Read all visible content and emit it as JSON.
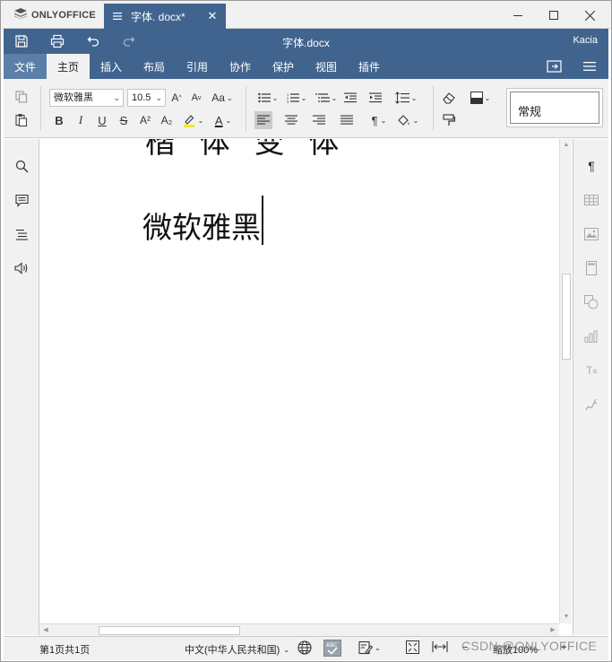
{
  "app": {
    "brand": "ONLYOFFICE"
  },
  "tab": {
    "title": "字体. docx*"
  },
  "window": {
    "minimize": "–",
    "maximize": "☐",
    "close": "✕"
  },
  "header": {
    "doc_title": "字体.docx",
    "user": "Kacia"
  },
  "ribbon": {
    "tabs": [
      {
        "label": "文件"
      },
      {
        "label": "主页"
      },
      {
        "label": "插入"
      },
      {
        "label": "布局"
      },
      {
        "label": "引用"
      },
      {
        "label": "协作"
      },
      {
        "label": "保护"
      },
      {
        "label": "视图"
      },
      {
        "label": "插件"
      }
    ],
    "active_tab": "主页"
  },
  "toolbar": {
    "font_name": "微软雅黑",
    "font_size": "10.5",
    "grow_font": "A",
    "shrink_font": "A",
    "change_case": "Aa",
    "bold": "B",
    "italic": "I",
    "underline": "U",
    "strikethrough": "S",
    "superscript": "A²",
    "subscript": "A₂",
    "font_color_label": "A",
    "paragraph_mark": "¶",
    "style_name": "常规"
  },
  "document": {
    "cut_off_line": "  楷 体 变 体",
    "current_line": "微软雅黑"
  },
  "statusbar": {
    "page_info": "第1页共1页",
    "language": "中文(中华人民共和国)",
    "zoom": "缩放100%"
  },
  "watermark": "CSDN @ONLYOFFICE",
  "colors": {
    "header_blue": "#41648f",
    "ribbon_file": "#5b7fa8",
    "highlight_yellow": "#f8e71c",
    "font_color_red": "#d0021b"
  }
}
